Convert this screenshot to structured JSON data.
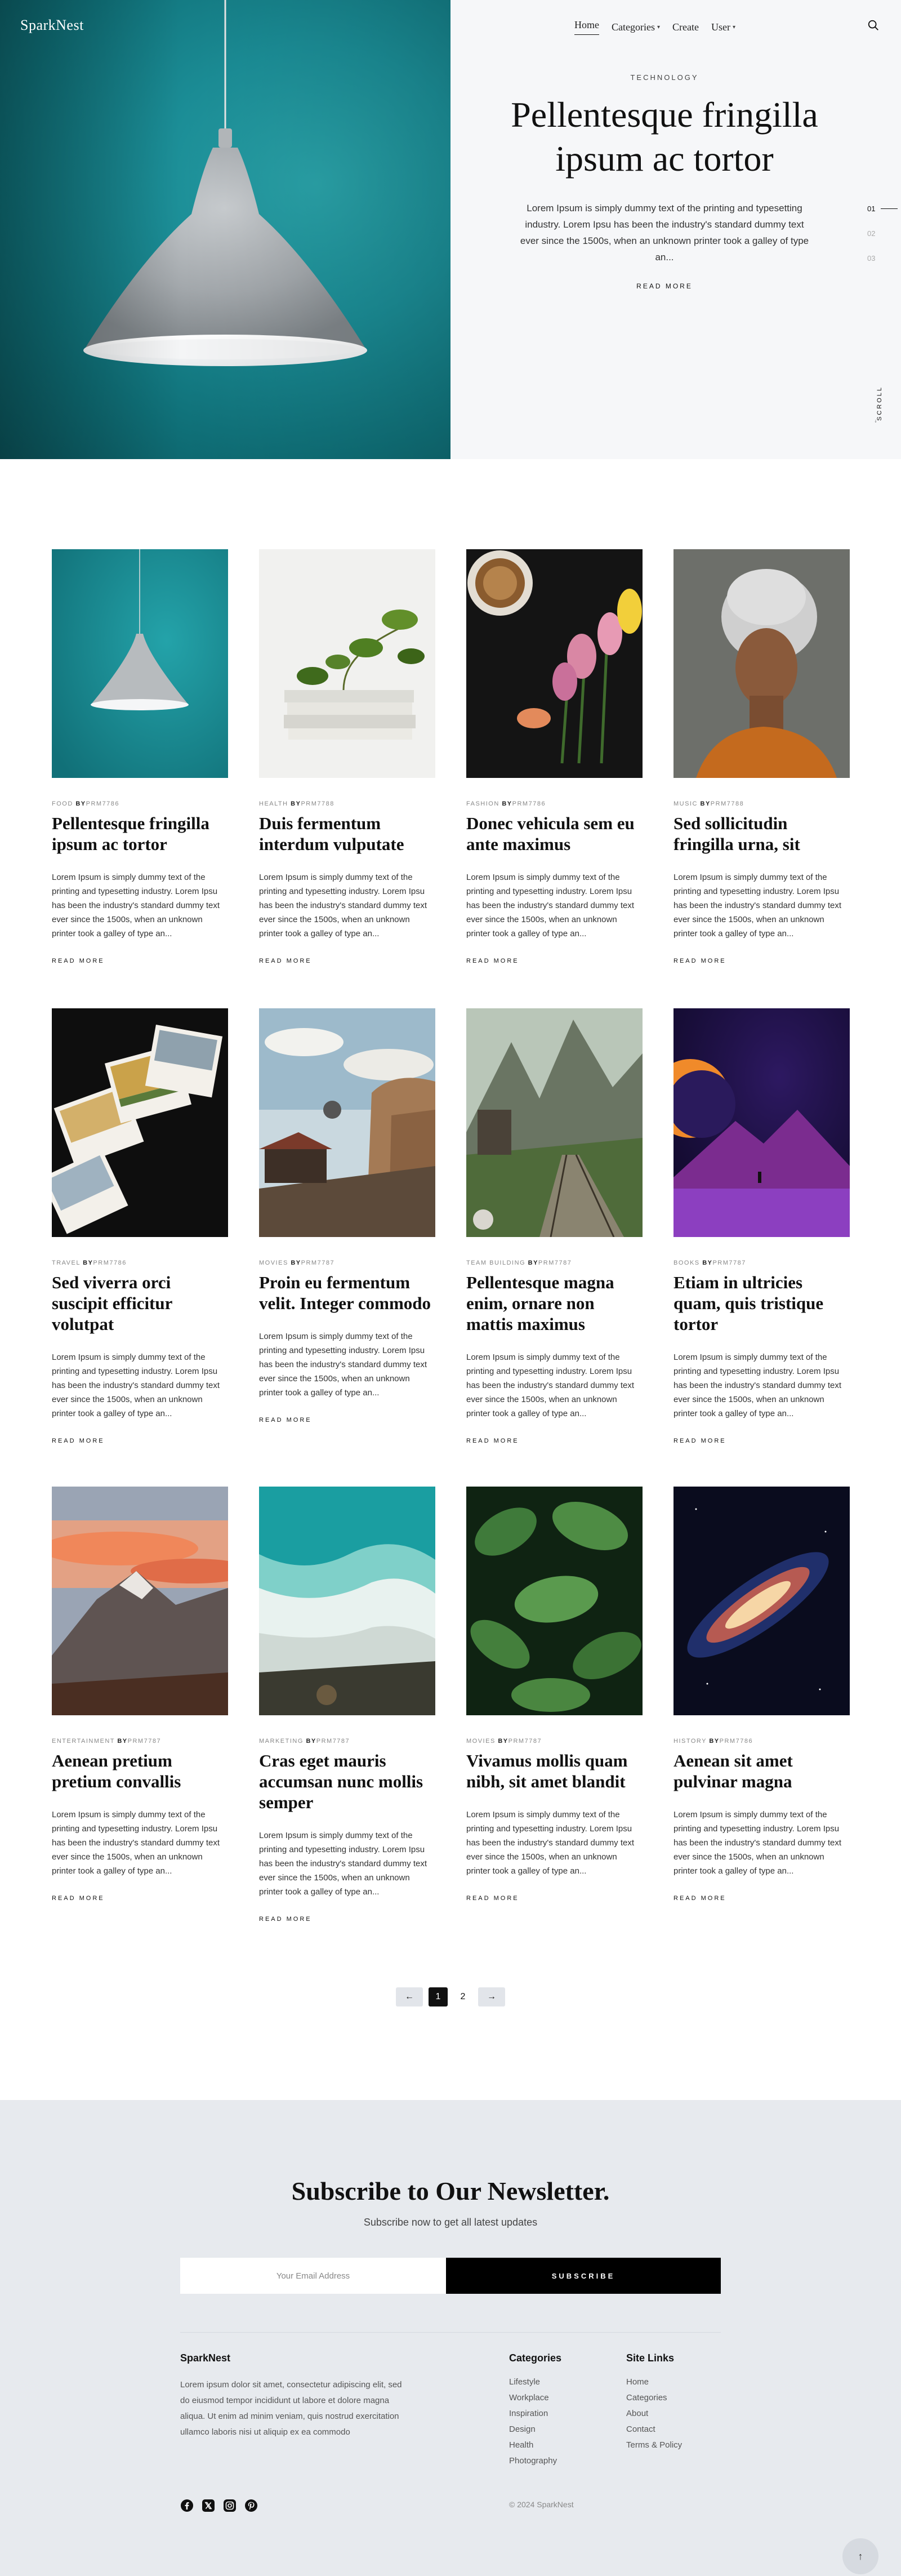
{
  "brand": "SparkNest",
  "nav": {
    "items": [
      {
        "label": "Home",
        "dropdown": false,
        "active": true
      },
      {
        "label": "Categories",
        "dropdown": true,
        "active": false
      },
      {
        "label": "Create",
        "dropdown": false,
        "active": false
      },
      {
        "label": "User",
        "dropdown": true,
        "active": false
      }
    ],
    "search_icon": "search-icon"
  },
  "hero": {
    "category": "TECHNOLOGY",
    "title": "Pellentesque fringilla ipsum ac tortor",
    "excerpt": "Lorem Ipsum is simply dummy text of the printing and typesetting industry. Lorem Ipsu has been the industry's standard dummy text ever since the 1500s, when an unknown printer took a galley of type an...",
    "read_more": "READ MORE",
    "slides": [
      "01",
      "02",
      "03"
    ],
    "active_slide": "01",
    "scroll_label": "SCROLL"
  },
  "posts": [
    {
      "category": "FOOD",
      "by": "BY",
      "author": "PRM7786",
      "title": "Pellentesque fringilla ipsum ac tortor",
      "excerpt": "Lorem Ipsum is simply dummy text of the printing and typesetting industry. Lorem Ipsu has been the industry's standard dummy text ever since the 1500s, when an unknown printer took a galley of type an...",
      "read_more": "READ MORE",
      "image": "teal-lamp"
    },
    {
      "category": "HEALTH",
      "by": "BY",
      "author": "PRM7788",
      "title": "Duis fermentum interdum vulputate",
      "excerpt": "Lorem Ipsum is simply dummy text of the printing and typesetting industry. Lorem Ipsu has been the industry's standard dummy text ever since the 1500s, when an unknown printer took a galley of type an...",
      "read_more": "READ MORE",
      "image": "books-plant"
    },
    {
      "category": "FASHION",
      "by": "BY",
      "author": "PRM7786",
      "title": "Donec vehicula sem eu ante maximus",
      "excerpt": "Lorem Ipsum is simply dummy text of the printing and typesetting industry. Lorem Ipsu has been the industry's standard dummy text ever since the 1500s, when an unknown printer took a galley of type an...",
      "read_more": "READ MORE",
      "image": "tulips-coffee"
    },
    {
      "category": "MUSIC",
      "by": "BY",
      "author": "PRM7788",
      "title": "Sed sollicitudin fringilla urna, sit",
      "excerpt": "Lorem Ipsum is simply dummy text of the printing and typesetting industry. Lorem Ipsu has been the industry's standard dummy text ever since the 1500s, when an unknown printer took a galley of type an...",
      "read_more": "READ MORE",
      "image": "woman-headwrap"
    },
    {
      "category": "TRAVEL",
      "by": "BY",
      "author": "PRM7786",
      "title": "Sed viverra orci suscipit efficitur volutpat",
      "excerpt": "Lorem Ipsum is simply dummy text of the printing and typesetting industry. Lorem Ipsu has been the industry's standard dummy text ever since the 1500s, when an unknown printer took a galley of type an...",
      "read_more": "READ MORE",
      "image": "postcards"
    },
    {
      "category": "MOVIES",
      "by": "BY",
      "author": "PRM7787",
      "title": "Proin eu fermentum velit. Integer commodo",
      "excerpt": "Lorem Ipsum is simply dummy text of the printing and typesetting industry. Lorem Ipsu has been the industry's standard dummy text ever since the 1500s, when an unknown printer took a galley of type an...",
      "read_more": "READ MORE",
      "image": "fantasy-city"
    },
    {
      "category": "TEAM BUILDING",
      "by": "BY",
      "author": "PRM7787",
      "title": "Pellentesque magna enim, ornare non mattis maximus",
      "excerpt": "Lorem Ipsum is simply dummy text of the printing and typesetting industry. Lorem Ipsu has been the industry's standard dummy text ever since the 1500s, when an unknown printer took a galley of type an...",
      "read_more": "READ MORE",
      "image": "mountain-railway"
    },
    {
      "category": "BOOKS",
      "by": "BY",
      "author": "PRM7787",
      "title": "Etiam in ultricies quam, quis tristique tortor",
      "excerpt": "Lorem Ipsum is simply dummy text of the printing and typesetting industry. Lorem Ipsu has been the industry's standard dummy text ever since the 1500s, when an unknown printer took a galley of type an...",
      "read_more": "READ MORE",
      "image": "purple-planet"
    },
    {
      "category": "ENTERTAINMENT",
      "by": "BY",
      "author": "PRM7787",
      "title": "Aenean pretium pretium convallis",
      "excerpt": "Lorem Ipsum is simply dummy text of the printing and typesetting industry. Lorem Ipsu has been the industry's standard dummy text ever since the 1500s, when an unknown printer took a galley of type an...",
      "read_more": "READ MORE",
      "image": "sunset-mountain"
    },
    {
      "category": "MARKETING",
      "by": "BY",
      "author": "PRM7787",
      "title": "Cras eget mauris accumsan nunc mollis semper",
      "excerpt": "Lorem Ipsum is simply dummy text of the printing and typesetting industry. Lorem Ipsu has been the industry's standard dummy text ever since the 1500s, when an unknown printer took a galley of type an...",
      "read_more": "READ MORE",
      "image": "ocean-waves"
    },
    {
      "category": "MOVIES",
      "by": "BY",
      "author": "PRM7787",
      "title": "Vivamus mollis quam nibh, sit amet blandit",
      "excerpt": "Lorem Ipsum is simply dummy text of the printing and typesetting industry. Lorem Ipsu has been the industry's standard dummy text ever since the 1500s, when an unknown printer took a galley of type an...",
      "read_more": "READ MORE",
      "image": "green-leaves"
    },
    {
      "category": "HISTORY",
      "by": "BY",
      "author": "PRM7786",
      "title": "Aenean sit amet pulvinar magna",
      "excerpt": "Lorem Ipsum is simply dummy text of the printing and typesetting industry. Lorem Ipsu has been the industry's standard dummy text ever since the 1500s, when an unknown printer took a galley of type an...",
      "read_more": "READ MORE",
      "image": "galaxy"
    }
  ],
  "pagination": {
    "prev": "←",
    "pages": [
      "1",
      "2"
    ],
    "current": "1",
    "next": "→"
  },
  "newsletter": {
    "title": "Subscribe to Our Newsletter.",
    "subtitle": "Subscribe now to get all latest updates",
    "placeholder": "Your Email Address",
    "button": "SUBSCRIBE"
  },
  "footer": {
    "brand": "SparkNest",
    "about": "Lorem ipsum dolor sit amet, consectetur adipiscing elit, sed do eiusmod tempor incididunt ut labore et dolore magna aliqua. Ut enim ad minim veniam, quis nostrud exercitation ullamco laboris nisi ut aliquip ex ea commodo",
    "categories_title": "Categories",
    "categories": [
      "Lifestyle",
      "Workplace",
      "Inspiration",
      "Design",
      "Health",
      "Photography"
    ],
    "links_title": "Site Links",
    "links": [
      "Home",
      "Categories",
      "About",
      "Contact",
      "Terms & Policy"
    ],
    "social": [
      "facebook-icon",
      "x-icon",
      "instagram-icon",
      "pinterest-icon"
    ],
    "copyright": "© 2024 SparkNest",
    "to_top": "↑"
  }
}
